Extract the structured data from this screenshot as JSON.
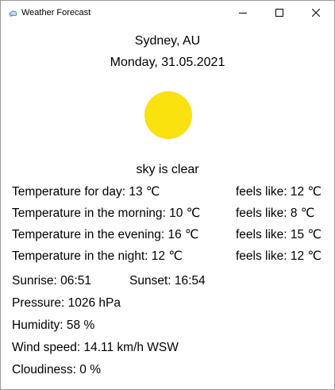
{
  "window": {
    "title": "Weather Forecast"
  },
  "location": {
    "city": "Sydney, AU",
    "date": "Monday, 31.05.2021"
  },
  "condition": {
    "icon": "sun-icon",
    "sun_color": "#F9E20E",
    "description": "sky is clear"
  },
  "temperatures": {
    "day": "Temperature for day: 13 ℃",
    "day_feels": "feels like: 12 ℃",
    "morning": "Temperature in the morning: 10 ℃",
    "morning_feels": "feels like: 8 ℃",
    "evening": "Temperature in the evening: 16 ℃",
    "evening_feels": "feels like: 15 ℃",
    "night": "Temperature in the night: 12 ℃",
    "night_feels": "feels like: 12 ℃"
  },
  "sun": {
    "sunrise": "Sunrise: 06:51",
    "sunset": "Sunset: 16:54"
  },
  "details": {
    "pressure": "Pressure: 1026 hPa",
    "humidity": "Humidity: 58 %",
    "wind": "Wind speed: 14.11 km/h WSW",
    "cloudiness": "Cloudiness: 0 %"
  }
}
